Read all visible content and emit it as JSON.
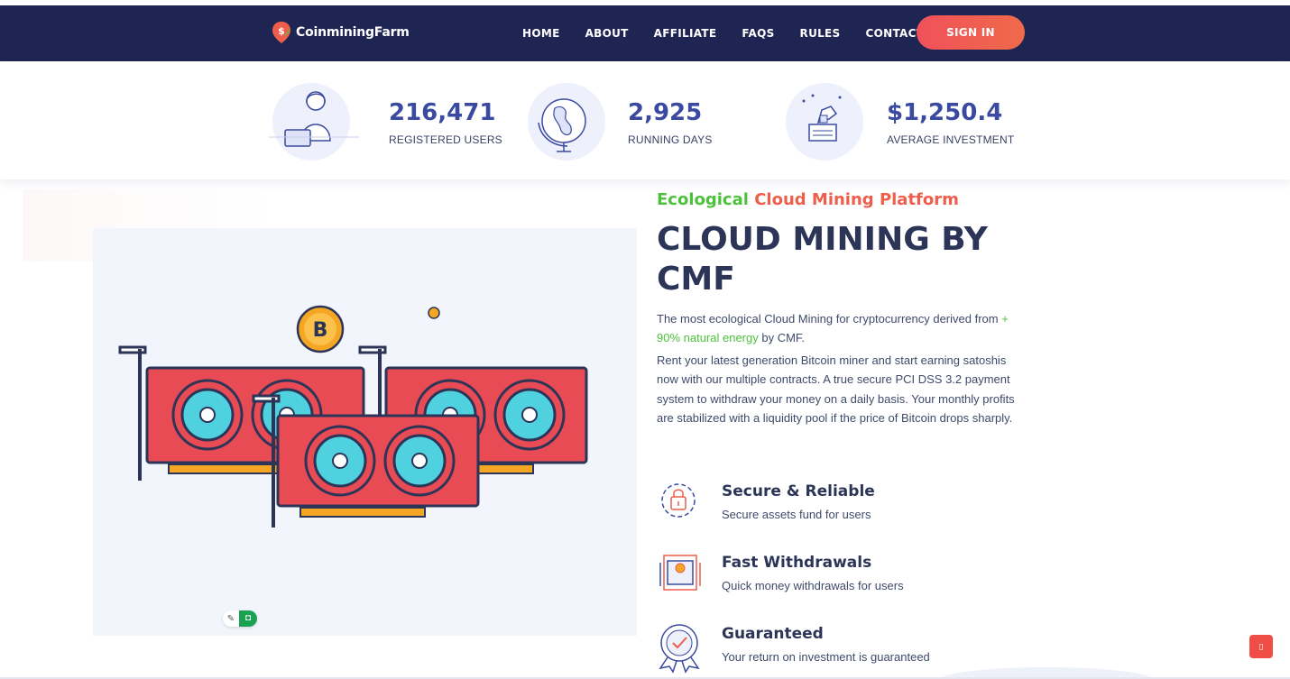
{
  "header": {
    "logo_text": "CoinminingFarm",
    "nav": [
      "HOME",
      "ABOUT",
      "AFFILIATE",
      "FAQS",
      "RULES",
      "CONTACT"
    ],
    "sign_in": "SIGN IN"
  },
  "stats": [
    {
      "value": "216,471",
      "label": "REGISTERED USERS",
      "icon": "support-agent-icon"
    },
    {
      "value": "2,925",
      "label": "RUNNING DAYS",
      "icon": "globe-icon"
    },
    {
      "value": "$1,250.4",
      "label": "AVERAGE INVESTMENT",
      "icon": "invest-hand-icon"
    }
  ],
  "hero": {
    "eyebrow_green": "Ecological",
    "eyebrow_red": "Cloud Mining Platform",
    "headline": "CLOUD MINING BY CMF",
    "p1_before": "The most ecological Cloud Mining for cryptocurrency derived from ",
    "p1_highlight": "+ 90% natural energy",
    "p1_after": " by CMF.",
    "p2": "Rent your latest generation Bitcoin miner and start earning satoshis now with our multiple contracts. A true secure PCI DSS 3.2 payment system to withdraw your money on a daily basis. Your monthly profits are stabilized with a liquidity pool if the price of Bitcoin drops sharply.",
    "image_icon": "gpu-miners-illustration",
    "coin_symbol": "B",
    "pill_pen": "✎",
    "pill_bot": "◘"
  },
  "features": [
    {
      "title": "Secure & Reliable",
      "desc": "Secure assets fund for users",
      "icon": "secure-lock-icon"
    },
    {
      "title": "Fast Withdrawals",
      "desc": "Quick money withdrawals for users",
      "icon": "withdraw-icon"
    },
    {
      "title": "Guaranteed",
      "desc": "Your return on investment is guaranteed",
      "icon": "guarantee-badge-icon"
    }
  ],
  "scroll_top_glyph": "▯",
  "colors": {
    "header_bg": "#1f2553",
    "accent_red": "#ef5d4b",
    "accent_green": "#4cc23b",
    "stat_blue": "#3a4aa0",
    "heading": "#2c3557"
  }
}
